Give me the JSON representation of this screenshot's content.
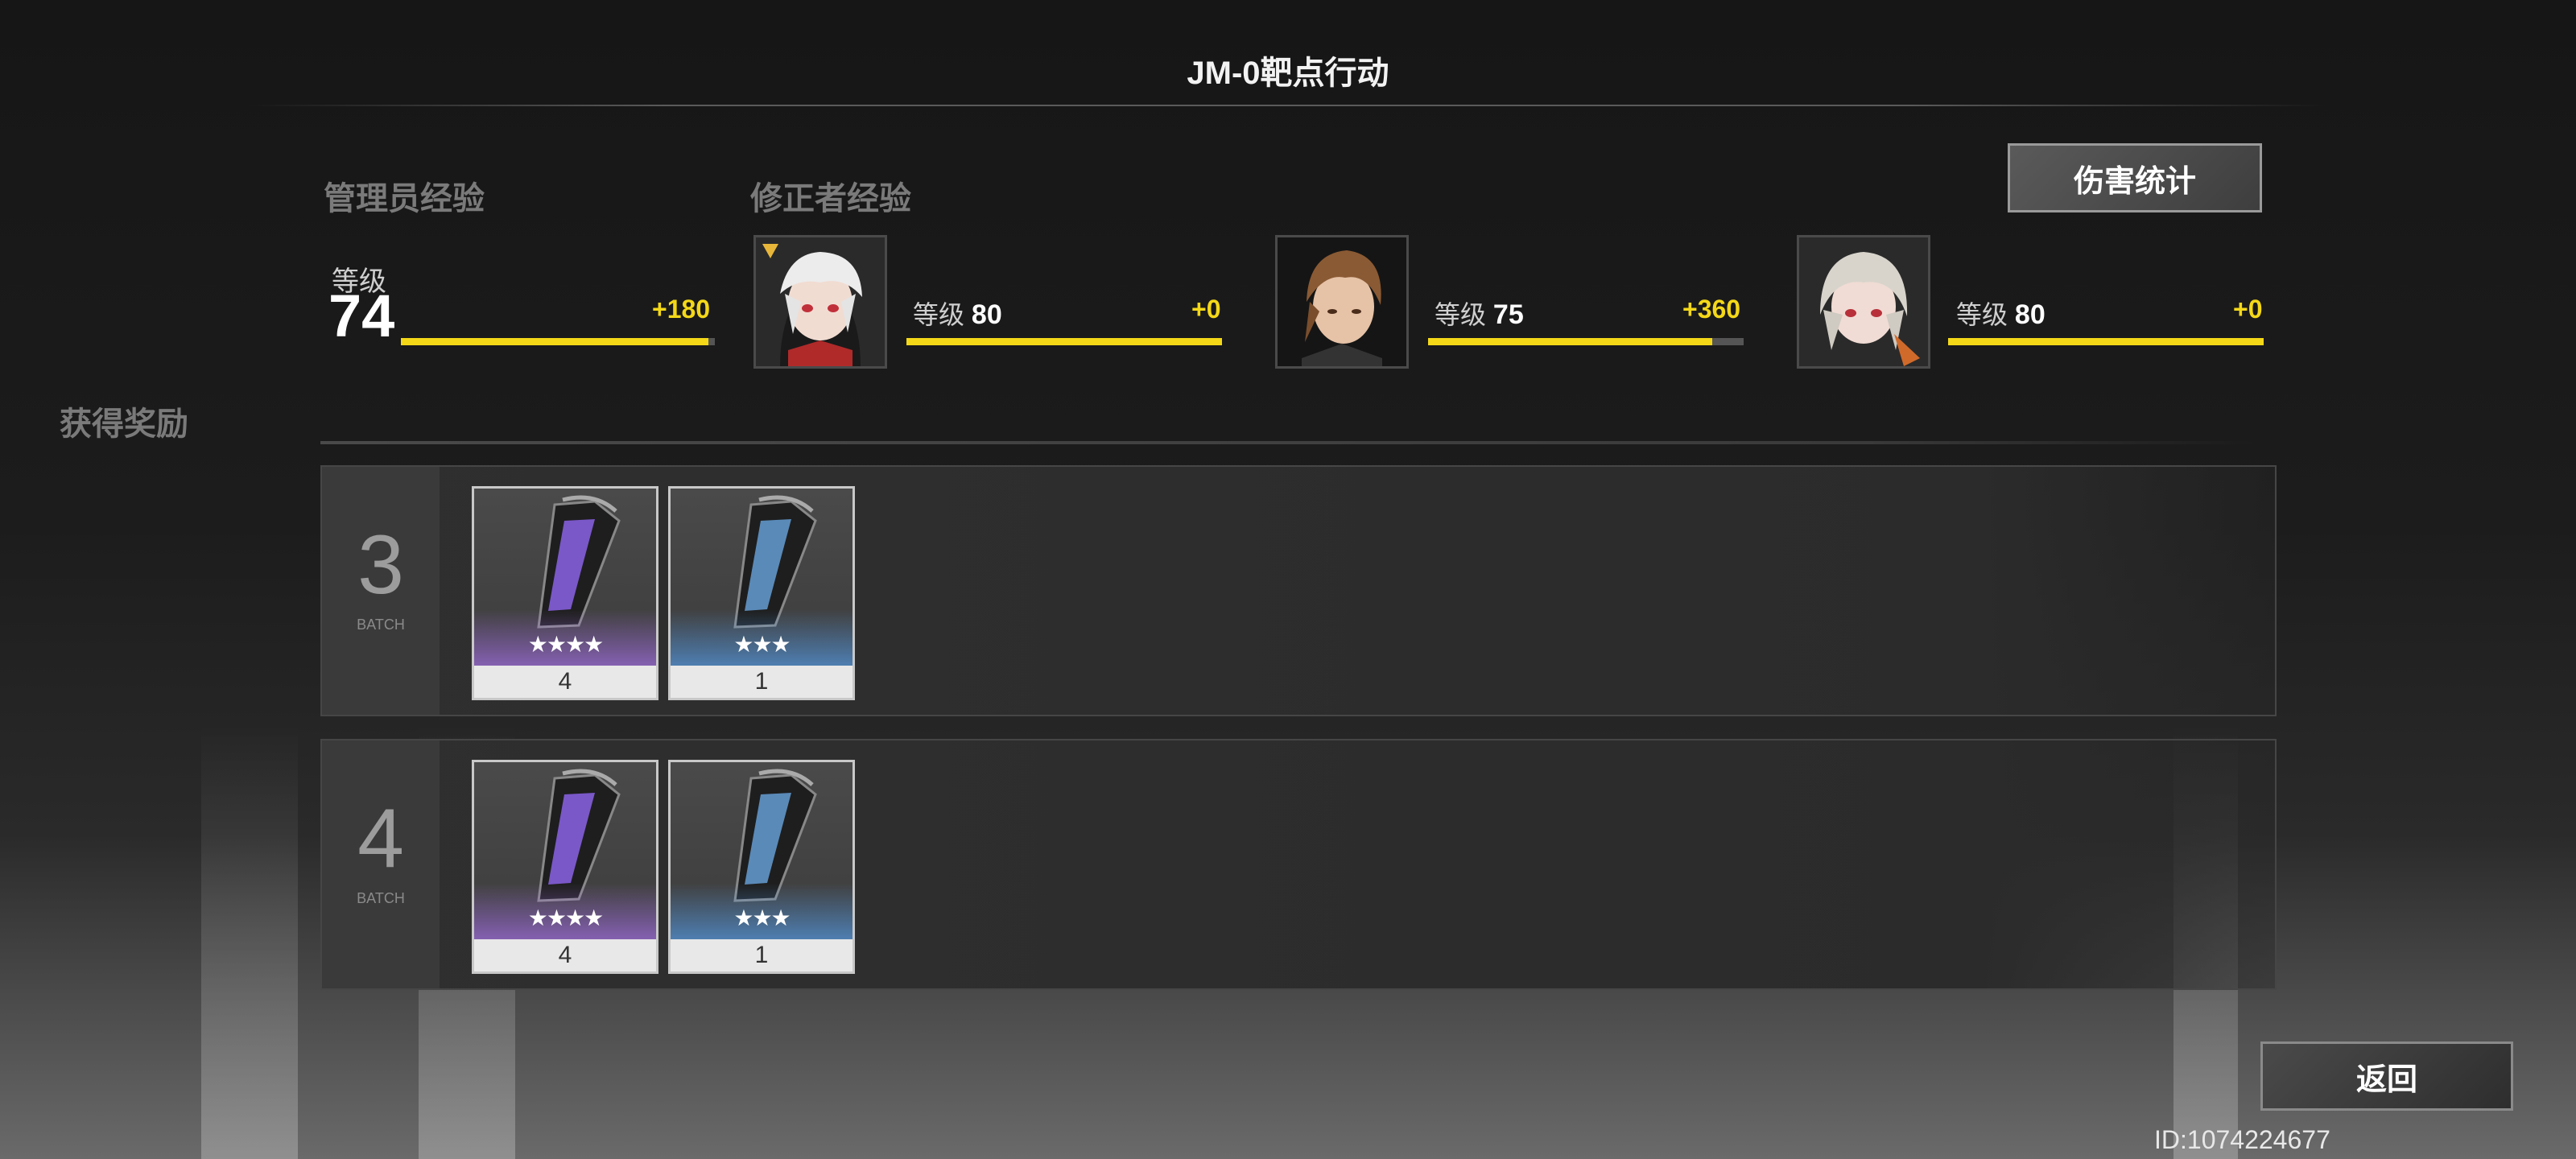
{
  "header": {
    "title": "JM-0靶点行动"
  },
  "labels": {
    "admin_exp": "管理员经验",
    "modifier_exp": "修正者经验",
    "rewards": "获得奖励",
    "level_word": "等级"
  },
  "buttons": {
    "damage_stats": "伤害统计",
    "back": "返回"
  },
  "admin": {
    "level": "74",
    "exp_gain": "+180",
    "progress": 0.98
  },
  "modifiers": [
    {
      "level": "80",
      "exp_gain": "+0",
      "progress": 1.0,
      "portrait": "white-hair-red-eye-character"
    },
    {
      "level": "75",
      "exp_gain": "+360",
      "progress": 0.9,
      "portrait": "brown-hair-male-character"
    },
    {
      "level": "80",
      "exp_gain": "+0",
      "progress": 1.0,
      "portrait": "silver-hair-character"
    }
  ],
  "batches": [
    {
      "number": "3",
      "word": "BATCH",
      "items": [
        {
          "rarity": 4,
          "stars": "★★★★",
          "qty": "4",
          "color": "purple"
        },
        {
          "rarity": 3,
          "stars": "★★★",
          "qty": "1",
          "color": "blue"
        }
      ]
    },
    {
      "number": "4",
      "word": "BATCH",
      "items": [
        {
          "rarity": 4,
          "stars": "★★★★",
          "qty": "4",
          "color": "purple"
        },
        {
          "rarity": 3,
          "stars": "★★★",
          "qty": "1",
          "color": "blue"
        }
      ]
    }
  ],
  "footer": {
    "uid": "ID:1074224677"
  },
  "colors": {
    "accent": "#f4d818",
    "purple": "#b478ff",
    "blue": "#5aaaff"
  }
}
